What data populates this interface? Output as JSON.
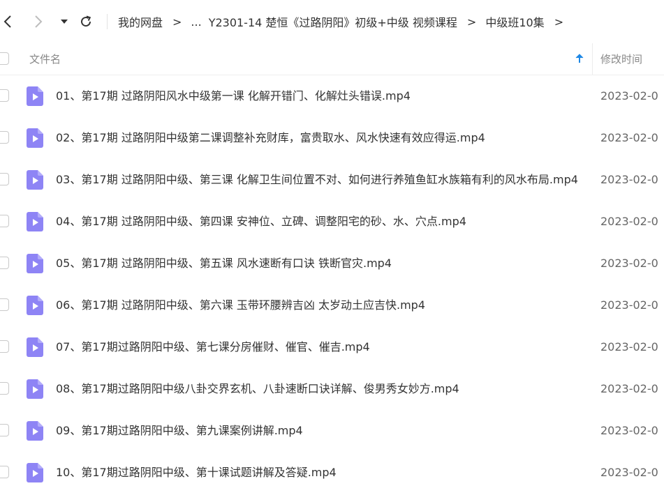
{
  "nav": {
    "back_icon": "chevron-left-icon",
    "forward_icon": "chevron-right-icon",
    "dropdown_icon": "caret-down-icon",
    "refresh_icon": "refresh-icon"
  },
  "breadcrumb": {
    "separator": ">",
    "items": [
      "我的网盘",
      "...",
      "Y2301-14 楚恒《过路阴阳》初级+中级 视频课程",
      "中级班10集"
    ]
  },
  "table": {
    "col_name": "文件名",
    "col_time": "修改时间",
    "sort_icon": "arrow-up-icon",
    "accent_color": "#1e88e5",
    "file_icon_color": "#8e84f5",
    "rows": [
      {
        "name": "01、第17期 过路阴阳风水中级第一课 化解开错门、化解灶头错误.mp4",
        "time": "2023-02-0"
      },
      {
        "name": "02、第17期 过路阴阳中级第二课调整补充财库，富贵取水、风水快速有效应得运.mp4",
        "time": "2023-02-0"
      },
      {
        "name": "03、第17期 过路阴阳中级、第三课 化解卫生间位置不对、如何进行养殖鱼缸水族箱有利的风水布局.mp4",
        "time": "2023-02-0"
      },
      {
        "name": "04、第17期 过路阴阳中级、第四课 安神位、立碑、调整阳宅的砂、水、穴点.mp4",
        "time": "2023-02-0"
      },
      {
        "name": "05、第17期 过路阴阳中级、第五课 风水速断有口诀 铁断官灾.mp4",
        "time": "2023-02-0"
      },
      {
        "name": "06、第17期 过路阴阳中级、第六课 玉带环腰辨吉凶 太岁动土应吉快.mp4",
        "time": "2023-02-0"
      },
      {
        "name": "07、第17期过路阴阳中级、第七课分房催财、催官、催吉.mp4",
        "time": "2023-02-0"
      },
      {
        "name": "08、第17期过路阴阳中级八卦交界玄机、八卦速断口诀详解、俊男秀女妙方.mp4",
        "time": "2023-02-0"
      },
      {
        "name": "09、第17期过路阴阳中级、第九课案例讲解.mp4",
        "time": "2023-02-0"
      },
      {
        "name": "10、第17期过路阴阳中级、第十课试题讲解及答疑.mp4",
        "time": "2023-02-0"
      }
    ]
  }
}
